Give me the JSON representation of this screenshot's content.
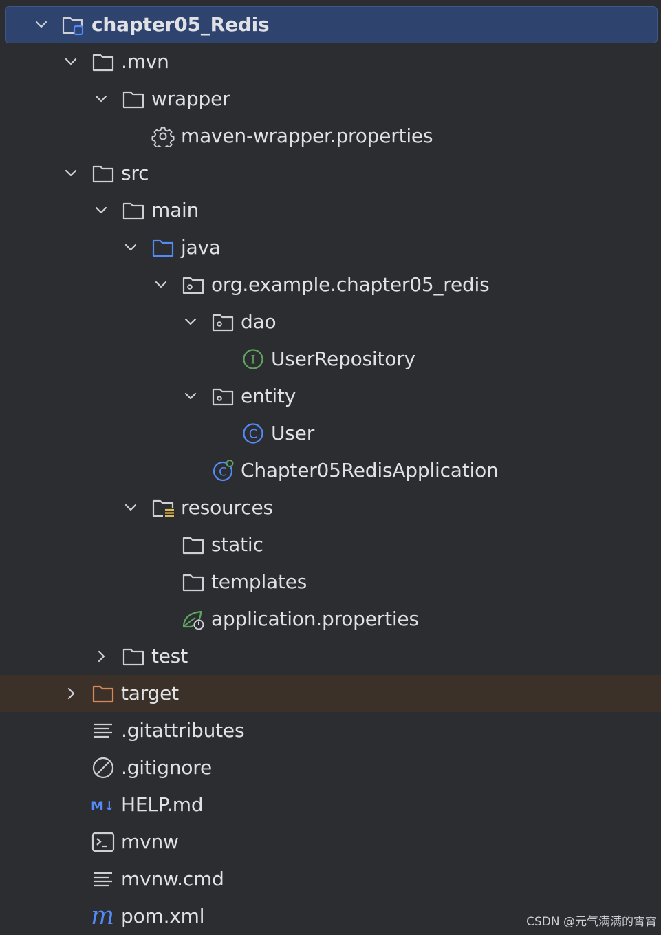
{
  "project_tree": {
    "root": "chapter05_Redis",
    "mvn": ".mvn",
    "wrapper": "wrapper",
    "maven_wrapper_properties": "maven-wrapper.properties",
    "src": "src",
    "main": "main",
    "java": "java",
    "package": "org.example.chapter05_redis",
    "dao": "dao",
    "user_repository": "UserRepository",
    "entity": "entity",
    "user": "User",
    "application_class": "Chapter05RedisApplication",
    "resources": "resources",
    "static": "static",
    "templates": "templates",
    "application_properties": "application.properties",
    "test": "test",
    "target": "target",
    "gitattributes": ".gitattributes",
    "gitignore": ".gitignore",
    "help_md": "HELP.md",
    "mvnw": "mvnw",
    "mvnw_cmd": "mvnw.cmd",
    "pom_xml": "pom.xml"
  },
  "icon_glyphs": {
    "interface": "I",
    "class": "C",
    "markdown": "M↓",
    "maven": "m"
  },
  "colors": {
    "background": "#2b2d30",
    "selection": "#2e436e",
    "excluded_row": "#3b3128",
    "text": "#dfe1e5",
    "folder": "#ced0d6",
    "source_folder": "#548af7",
    "resource_marker": "#e0b94f",
    "interface": "#5fa45f",
    "class": "#548af7",
    "spring_green": "#5fa45f",
    "excluded_folder": "#d9875a"
  },
  "watermark": "CSDN @元气满满的霄霄"
}
